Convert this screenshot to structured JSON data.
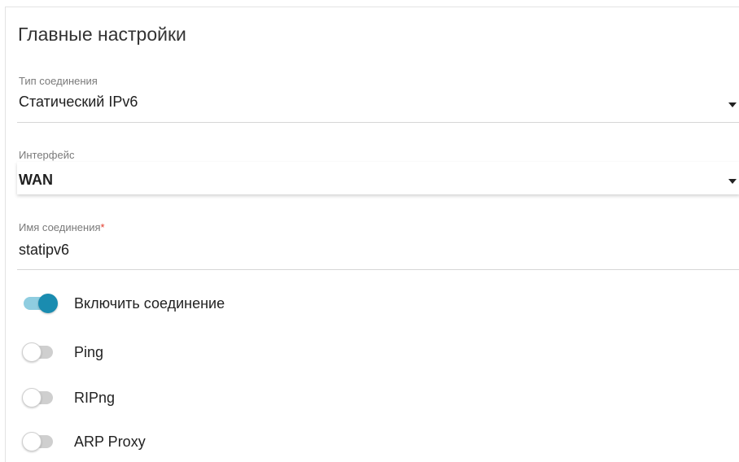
{
  "section": {
    "title": "Главные настройки"
  },
  "fields": {
    "connection_type": {
      "label": "Тип соединения",
      "value": "Статический IPv6"
    },
    "interface": {
      "label": "Интерфейс",
      "value": "WAN"
    },
    "connection_name": {
      "label": "Имя соединения",
      "required_mark": "*",
      "value": "statipv6"
    }
  },
  "toggles": [
    {
      "label": "Включить соединение",
      "state": "on"
    },
    {
      "label": "Ping",
      "state": "off"
    },
    {
      "label": "RIPng",
      "state": "off"
    },
    {
      "label": "ARP Proxy",
      "state": "off"
    }
  ],
  "colors": {
    "accent": "#1a8cb0",
    "accent_track": "#8fcde0",
    "required": "#e23a2a"
  }
}
